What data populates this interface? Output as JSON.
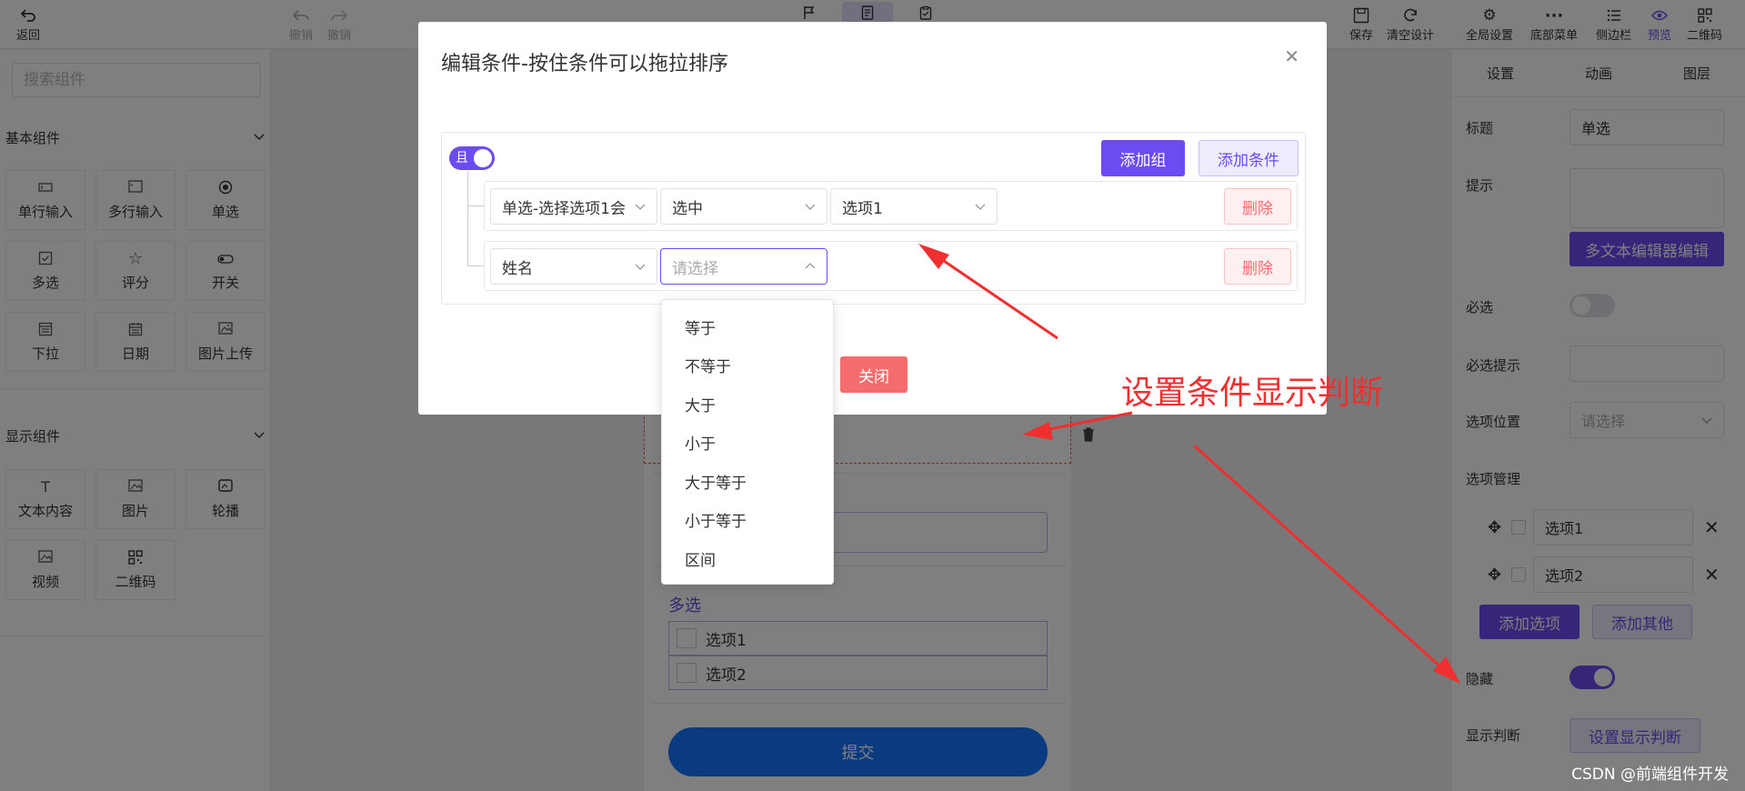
{
  "toolbar": {
    "back": "返回",
    "undo": "撤销",
    "redo": "撤销",
    "save": "保存",
    "clear": "清空设计",
    "global": "全局设置",
    "bottom_menu": "底部菜单",
    "sidebar": "侧边栏",
    "preview": "预览",
    "qrcode": "二维码"
  },
  "left_panel": {
    "search_placeholder": "搜索组件",
    "basic_title": "基本组件",
    "basic": [
      "单行输入",
      "多行输入",
      "单选",
      "多选",
      "评分",
      "开关",
      "下拉",
      "日期",
      "图片上传"
    ],
    "display_title": "显示组件",
    "display": [
      "文本内容",
      "图片",
      "轮播",
      "视频",
      "二维码"
    ]
  },
  "canvas": {
    "checkbox_label": "多选",
    "checkbox_options": [
      "选项1",
      "选项2"
    ],
    "submit": "提交"
  },
  "right_panel": {
    "tabs": [
      "设置",
      "动画",
      "图层"
    ],
    "title_label": "标题",
    "title_value": "单选",
    "hint_label": "提示",
    "rich_edit": "多文本编辑器编辑",
    "required_label": "必选",
    "required_hint_label": "必选提示",
    "option_pos_label": "选项位置",
    "option_pos_placeholder": "请选择",
    "option_mgmt_label": "选项管理",
    "options": [
      "选项1",
      "选项2"
    ],
    "add_option": "添加选项",
    "add_other": "添加其他",
    "hidden_label": "隐藏",
    "display_rule_label": "显示判断",
    "display_rule_btn": "设置显示判断"
  },
  "modal": {
    "title": "编辑条件-按住条件可以拖拉排序",
    "and_label": "且",
    "add_group": "添加组",
    "add_condition": "添加条件",
    "rows": [
      {
        "field": "单选-选择选项1会",
        "operator": "选中",
        "value": "选项1",
        "delete": "删除"
      },
      {
        "field": "姓名",
        "operator_placeholder": "请选择",
        "delete": "删除"
      }
    ],
    "close": "关闭",
    "dropdown_options": [
      "等于",
      "不等于",
      "大于",
      "小于",
      "大于等于",
      "小于等于",
      "区间"
    ]
  },
  "annotation": "设置条件显示判断",
  "watermark": "CSDN @前端组件开发",
  "colors": {
    "accent": "#6c4bf0",
    "danger": "#f56c6c",
    "annotation": "#f03030",
    "submit": "#1677ff"
  }
}
